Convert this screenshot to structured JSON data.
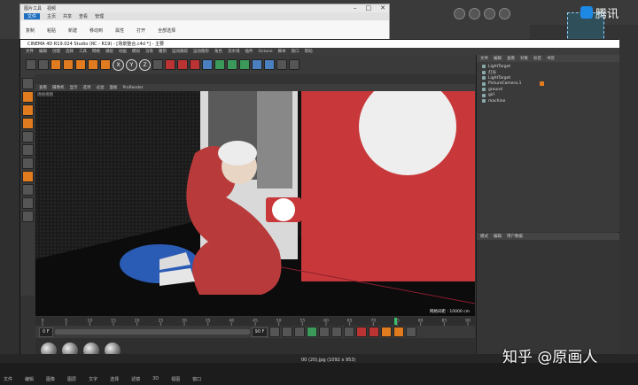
{
  "explorer": {
    "title": "图片工具",
    "subtitle": "视频",
    "tabs": [
      "文件",
      "主页",
      "共享",
      "查看",
      "管理"
    ],
    "ribbon": [
      "复制",
      "粘贴",
      "新建",
      "移动到",
      "属性",
      "打开",
      "全部选择"
    ]
  },
  "c4d": {
    "title": "CINEMA 4D R19.024 Studio (RC - R19) - [场景整合.c4d *] - 主要",
    "menu": [
      "文件",
      "编辑",
      "创建",
      "选择",
      "工具",
      "网格",
      "捕捉",
      "动画",
      "模拟",
      "渲染",
      "雕刻",
      "运动跟踪",
      "运动图形",
      "角色",
      "流水线",
      "插件",
      "Octane",
      "脚本",
      "窗口",
      "帮助"
    ],
    "axes": [
      "X",
      "Y",
      "Z"
    ],
    "viewport_menu": [
      "查看",
      "摄像机",
      "显示",
      "选项",
      "过滤",
      "面板",
      "ProRender"
    ],
    "viewport_label": "透视视图",
    "grid_info": "网格间距 : 10000 cm",
    "transport": {
      "frame_start": "0 F",
      "frame_end": "90 F",
      "current": "0 F"
    },
    "timeline_ticks": [
      "0",
      "5",
      "10",
      "15",
      "20",
      "25",
      "30",
      "35",
      "40",
      "45",
      "50",
      "55",
      "60",
      "65",
      "70",
      "75",
      "80",
      "85",
      "90"
    ]
  },
  "object_manager": {
    "tabs": [
      "文件",
      "编辑",
      "查看",
      "对象",
      "标签",
      "书签"
    ],
    "items": [
      "LightTarget",
      "灯光",
      "LightTarget",
      "PictureCamera.1",
      "ground",
      "girl",
      "machine"
    ]
  },
  "attribute_manager": {
    "tabs": [
      "模式",
      "编辑",
      "用户数据"
    ]
  },
  "bottom": {
    "filename": "00 (20).jpg (1092 x 953)",
    "host_menu": [
      "文件",
      "编辑",
      "图像",
      "图层",
      "文字",
      "选择",
      "滤镜",
      "3D",
      "视图",
      "窗口"
    ]
  },
  "brand": {
    "name": "腾讯"
  },
  "watermark": "知乎 @原画人",
  "colors": {
    "accent_blue": "#1e6fbf",
    "vending_red": "#c8383a",
    "c4d_orange": "#e07b1f"
  }
}
